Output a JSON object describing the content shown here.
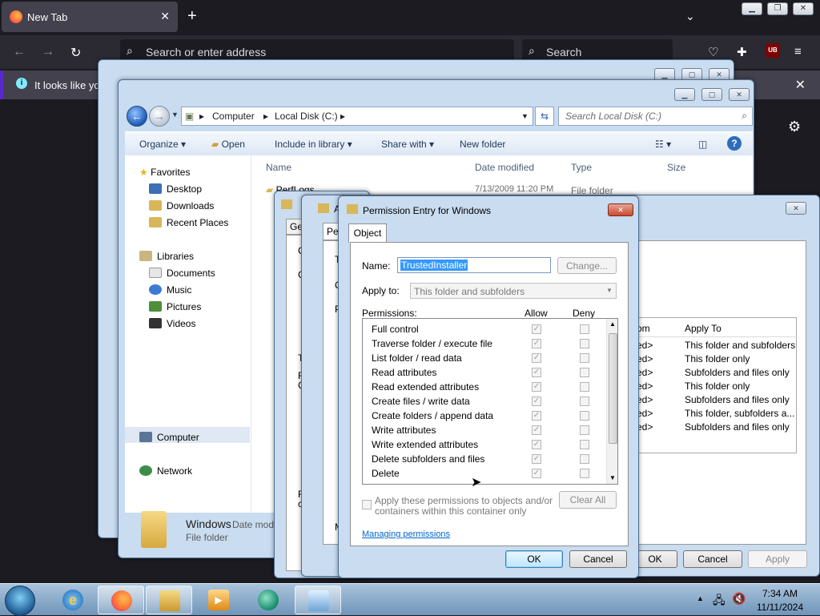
{
  "firefox": {
    "tab_title": "New Tab",
    "address_placeholder": "Search or enter address",
    "search_placeholder": "Search",
    "notice_text": "It looks like you",
    "ublock_label": "UB"
  },
  "explorer": {
    "breadcrumbs": [
      "Computer",
      "Local Disk (C:)"
    ],
    "search_placeholder": "Search Local Disk (C:)",
    "commands": [
      "Organize",
      "Open",
      "Include in library",
      "Share with",
      "New folder"
    ],
    "columns": [
      "Name",
      "Date modified",
      "Type",
      "Size"
    ],
    "first_row": {
      "name": "PerfLogs",
      "date": "7/13/2009 11:20 PM",
      "type": "File folder"
    },
    "nav": {
      "favorites": "Favorites",
      "favorites_items": [
        "Desktop",
        "Downloads",
        "Recent Places"
      ],
      "libraries": "Libraries",
      "libraries_items": [
        "Documents",
        "Music",
        "Pictures",
        "Videos"
      ],
      "computer": "Computer",
      "network": "Network"
    },
    "details": {
      "name": "Windows",
      "date_label": "Date mod",
      "type": "File folder"
    }
  },
  "adv_security": {
    "apply_to_header": "Apply To",
    "from_header": "om",
    "rows": [
      {
        "from": "ed>",
        "apply": "This folder and subfolders"
      },
      {
        "from": "ed>",
        "apply": "This folder only"
      },
      {
        "from": "ed>",
        "apply": "Subfolders and files only"
      },
      {
        "from": "ed>",
        "apply": "This folder only"
      },
      {
        "from": "ed>",
        "apply": "Subfolders and files only"
      },
      {
        "from": "ed>",
        "apply": "This folder, subfolders a..."
      },
      {
        "from": "ed>",
        "apply": "Subfolders and files only"
      }
    ],
    "ok": "OK",
    "cancel": "Cancel",
    "apply": "Apply"
  },
  "perm_dialog": {
    "title": "Permission Entry for Windows",
    "tab": "Object",
    "name_label": "Name:",
    "name_value": "TrustedInstaller",
    "change_button": "Change...",
    "apply_to_label": "Apply to:",
    "apply_to_value": "This folder and subfolders",
    "permissions_label": "Permissions:",
    "allow_header": "Allow",
    "deny_header": "Deny",
    "permissions": [
      {
        "name": "Full control",
        "allow": true,
        "deny": false
      },
      {
        "name": "Traverse folder / execute file",
        "allow": true,
        "deny": false
      },
      {
        "name": "List folder / read data",
        "allow": true,
        "deny": false
      },
      {
        "name": "Read attributes",
        "allow": true,
        "deny": false
      },
      {
        "name": "Read extended attributes",
        "allow": true,
        "deny": false
      },
      {
        "name": "Create files / write data",
        "allow": true,
        "deny": false
      },
      {
        "name": "Create folders / append data",
        "allow": true,
        "deny": false
      },
      {
        "name": "Write attributes",
        "allow": true,
        "deny": false
      },
      {
        "name": "Write extended attributes",
        "allow": true,
        "deny": false
      },
      {
        "name": "Delete subfolders and files",
        "allow": true,
        "deny": false
      },
      {
        "name": "Delete",
        "allow": true,
        "deny": false
      }
    ],
    "apply_child_text_1": "Apply these permissions to objects and/or",
    "apply_child_text_2": "containers within this container only",
    "clear_all": "Clear All",
    "help_link": "Managing permissions",
    "ok": "OK",
    "cancel": "Cancel"
  },
  "taskbar": {
    "time": "7:34 AM",
    "date": "11/11/2024"
  },
  "bg_fragments": {
    "ge": "Ge",
    "pe": "Pe",
    "c1": "C",
    "g": "G",
    "t": "T",
    "c2": "C",
    "p": "P",
    "o": "O",
    "t2": "T",
    "f": "F",
    "c3": "C",
    "f2": "F",
    "c4": "c",
    "l": "L",
    "m": "M",
    "a": "A"
  }
}
